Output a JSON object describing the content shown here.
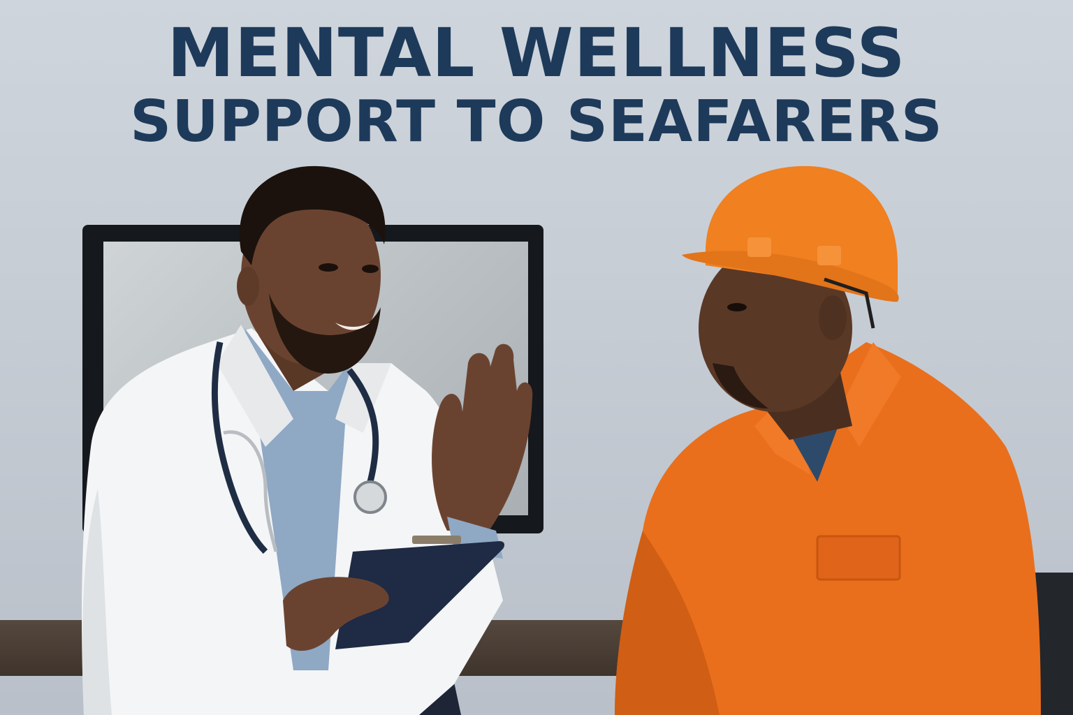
{
  "headline": {
    "line1": "MENTAL WELLNESS",
    "line2": "SUPPORT TO SEAFARERS"
  },
  "colors": {
    "headline": "#1e3a5a",
    "wall": "#c6ccd4",
    "lab_coat": "#f4f5f6",
    "hard_hat": "#f08020",
    "coverall": "#ea6f1c",
    "clipboard": "#1f2a44"
  }
}
